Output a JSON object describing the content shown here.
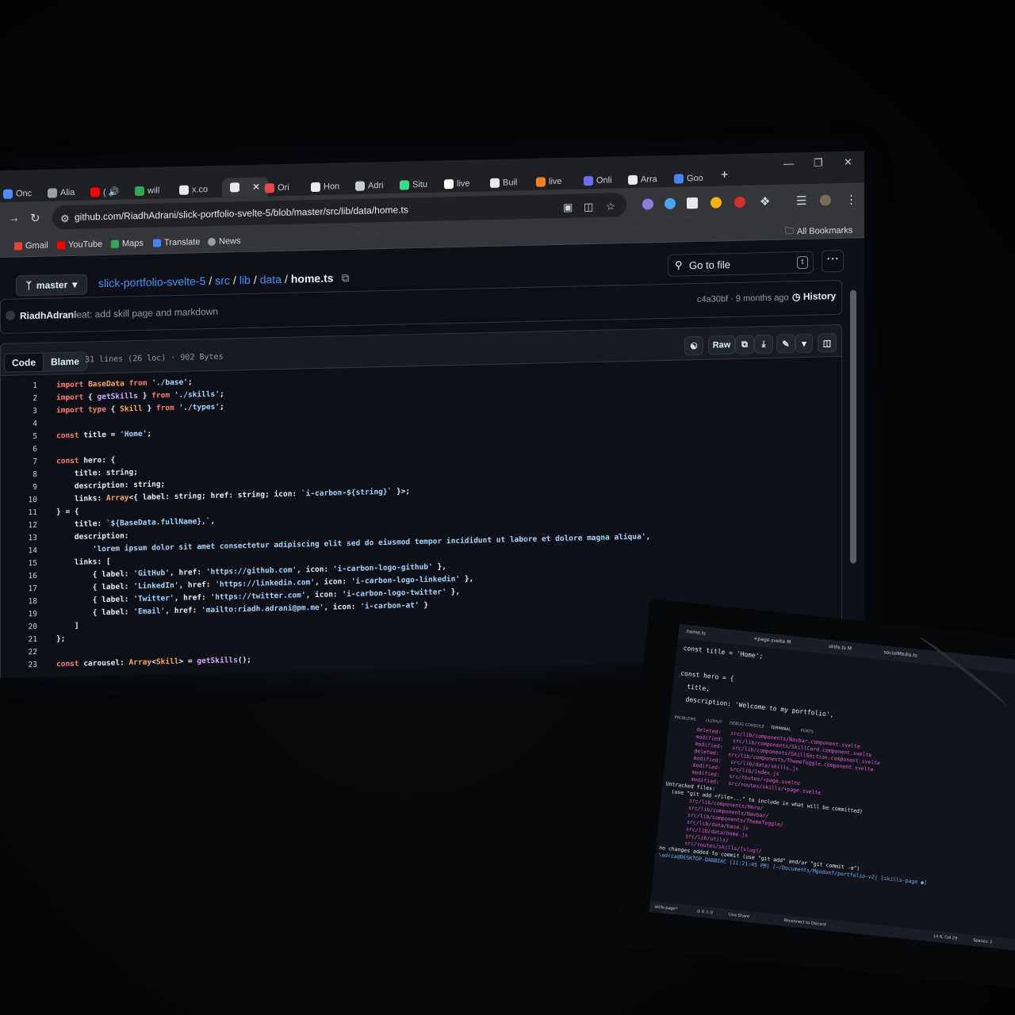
{
  "browser": {
    "tabs": [
      {
        "label": "Onc",
        "color": "#4a8df6"
      },
      {
        "label": "Alia",
        "color": "#9aa0a6"
      },
      {
        "label": "( 🔊",
        "color": "#ff0000"
      },
      {
        "label": "will",
        "color": "#34a853"
      },
      {
        "label": "x.co",
        "color": "#e8eaed"
      },
      {
        "label": "",
        "color": "#e8eaed"
      },
      {
        "label": "Ori",
        "color": "#e84a3f"
      },
      {
        "label": "Hon",
        "color": "#e8eaed"
      },
      {
        "label": "Adri",
        "color": "#c9ccd1"
      },
      {
        "label": "Situ",
        "color": "#3ddc84"
      },
      {
        "label": "live",
        "color": "#ffffff"
      },
      {
        "label": "Buil",
        "color": "#e8eaed"
      },
      {
        "label": "live",
        "color": "#f48024"
      },
      {
        "label": "Onli",
        "color": "#6e6ef5"
      },
      {
        "label": "Arra",
        "color": "#e8eaed"
      },
      {
        "label": "Goo",
        "color": "#4285f4"
      }
    ],
    "url": "github.com/RiadhAdrani/slick-portfolio-svelte-5/blob/master/src/lib/data/home.ts",
    "bookmarks": [
      "Gmail",
      "YouTube",
      "Maps",
      "Translate",
      "News"
    ],
    "all_bookmarks": "All Bookmarks"
  },
  "github": {
    "branch": "master",
    "breadcrumb": [
      "slick-portfolio-svelte-5",
      "src",
      "lib",
      "data"
    ],
    "filename": "home.ts",
    "go_to_file": "Go to file",
    "go_to_file_key": "t",
    "commit_author": "RiadhAdrani",
    "commit_message": "feat: add skill page and markdown",
    "commit_meta": "c4a30bf · 9 months ago",
    "history_label": "History",
    "code_tab": "Code",
    "blame_tab": "Blame",
    "file_info": "31 lines (26 loc) · 902 Bytes",
    "raw_label": "Raw"
  },
  "code_lines": [
    {
      "n": "1",
      "t": "import BaseData from './base';"
    },
    {
      "n": "2",
      "t": "import { getSkills } from './skills';"
    },
    {
      "n": "3",
      "t": "import type { Skill } from './types';"
    },
    {
      "n": "4",
      "t": ""
    },
    {
      "n": "5",
      "t": "const title = 'Home';"
    },
    {
      "n": "6",
      "t": ""
    },
    {
      "n": "7",
      "t": "const hero: {"
    },
    {
      "n": "8",
      "t": "    title: string;"
    },
    {
      "n": "9",
      "t": "    description: string;"
    },
    {
      "n": "10",
      "t": "    links: Array<{ label: string; href: string; icon: `i-carbon-${string}` }>;"
    },
    {
      "n": "11",
      "t": "} = {"
    },
    {
      "n": "12",
      "t": "    title: `${BaseData.fullName},`,"
    },
    {
      "n": "13",
      "t": "    description:"
    },
    {
      "n": "14",
      "t": "        'lorem ipsum dolor sit amet consectetur adipiscing elit sed do eiusmod tempor incididunt ut labore et dolore magna aliqua',"
    },
    {
      "n": "15",
      "t": "    links: ["
    },
    {
      "n": "16",
      "t": "        { label: 'GitHub', href: 'https://github.com', icon: 'i-carbon-logo-github' },"
    },
    {
      "n": "17",
      "t": "        { label: 'LinkedIn', href: 'https://linkedin.com', icon: 'i-carbon-logo-linkedin' },"
    },
    {
      "n": "18",
      "t": "        { label: 'Twitter', href: 'https://twitter.com', icon: 'i-carbon-logo-twitter' },"
    },
    {
      "n": "19",
      "t": "        { label: 'Email', href: 'mailto:riadh.adrani@pm.me', icon: 'i-carbon-at' }"
    },
    {
      "n": "20",
      "t": "    ]"
    },
    {
      "n": "21",
      "t": "};"
    },
    {
      "n": "22",
      "t": ""
    },
    {
      "n": "23",
      "t": "const carousel: Array<Skill> = getSkills();"
    }
  ],
  "laptop": {
    "tabs": [
      "home.ts",
      "+page.svelte M",
      "skills.ts M",
      "socialMedia.ts"
    ],
    "code": "const title = 'Home';\n\nconst hero = {\n  title,\n  description: 'Welcome to my portfolio',",
    "panel_tabs": [
      "PROBLEMS",
      "OUTPUT",
      "DEBUG CONSOLE",
      "TERMINAL",
      "PORTS"
    ],
    "terminal": [
      {
        "k": "deleted:",
        "v": "src/lib/components/Navbar.component.svelte"
      },
      {
        "k": "modified:",
        "v": "src/lib/components/SkillCard.component.svelte"
      },
      {
        "k": "modified:",
        "v": "src/lib/components/SkillSection.component.svelte"
      },
      {
        "k": "deleted:",
        "v": "src/lib/components/ThemeToggle.component.svelte"
      },
      {
        "k": "modified:",
        "v": "src/lib/data/skills.js"
      },
      {
        "k": "modified:",
        "v": "src/lib/index.js"
      },
      {
        "k": "modified:",
        "v": "src/routes/+page.svelte"
      },
      {
        "k": "modified:",
        "v": "src/routes/skills/+page.svelte"
      }
    ],
    "untracked_title": "Untracked files:",
    "untracked_hint": "  (use \"git add <file>...\" to include in what will be committed)",
    "untracked": [
      "src/lib/components/Hero/",
      "src/lib/components/Navbar/",
      "src/lib/components/ThemeToggle/",
      "src/lib/data/base.js",
      "src/lib/data/home.js",
      "src/lib/utils/",
      "src/routes/skills/[slug]/"
    ],
    "no_changes": "no changes added to commit (use \"git add\" and/or \"git commit -a\")",
    "prompt": "\\adria@DESKTOP-QA8BIAC [11:21:45 PM] [~/Documents/Mgodonf/portfolio-v2] [skills-page ●]",
    "status_items": [
      "skills-page*",
      "⊘ 0 ⚠ 0",
      "Live Share",
      "Reconnect to Discord",
      "Ln 6, Col 29",
      "Spaces: 2"
    ]
  }
}
